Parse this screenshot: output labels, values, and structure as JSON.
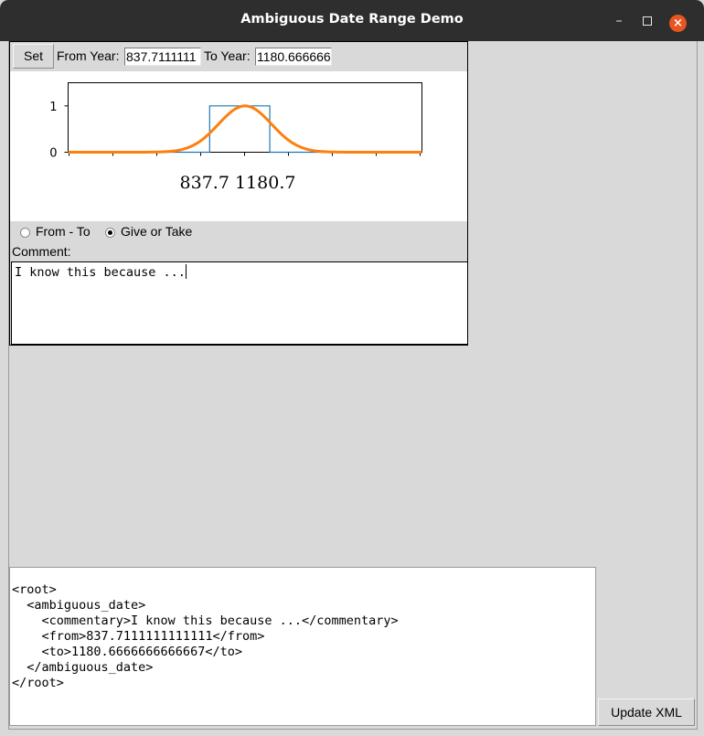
{
  "window": {
    "title": "Ambiguous Date Range Demo",
    "controls": [
      "–",
      "□",
      "×"
    ]
  },
  "toolbar": {
    "set_label": "Set",
    "from_label": "From Year:",
    "from_value": "837.7111111",
    "to_label": "To Year:",
    "to_value": "1180.666666"
  },
  "chart_data": {
    "type": "line",
    "ylim": [
      0,
      1.5
    ],
    "yticks": [
      "0",
      "1"
    ],
    "xlim": [
      0,
      10
    ],
    "xtick_count": 9,
    "series": [
      {
        "kind": "step",
        "color": "#1f77b4",
        "x": [
          0,
          4,
          4,
          5.7,
          5.7,
          10
        ],
        "y": [
          0,
          0,
          1,
          1,
          0,
          0
        ]
      },
      {
        "kind": "gaussian",
        "color": "#ff7f0e",
        "center": 5,
        "sigma": 0.75,
        "amplitude": 1
      }
    ],
    "range_label": "837.7 1180.7"
  },
  "slider": {
    "low_fraction": 0.41,
    "high_fraction": 0.58,
    "track_color": "#4a6b6b",
    "range_color": "#0044ff"
  },
  "mode": {
    "option1": "From - To",
    "option2": "Give or Take",
    "selected": "Give or Take"
  },
  "comment": {
    "label": "Comment:",
    "text": "I know this because ..."
  },
  "xml": {
    "lines": [
      "<root>",
      "  <ambiguous_date>",
      "    <commentary>I know this because ...</commentary>",
      "    <from>837.7111111111111</from>",
      "    <to>1180.6666666666667</to>",
      "  </ambiguous_date>",
      "</root>"
    ]
  },
  "update_label": "Update XML"
}
